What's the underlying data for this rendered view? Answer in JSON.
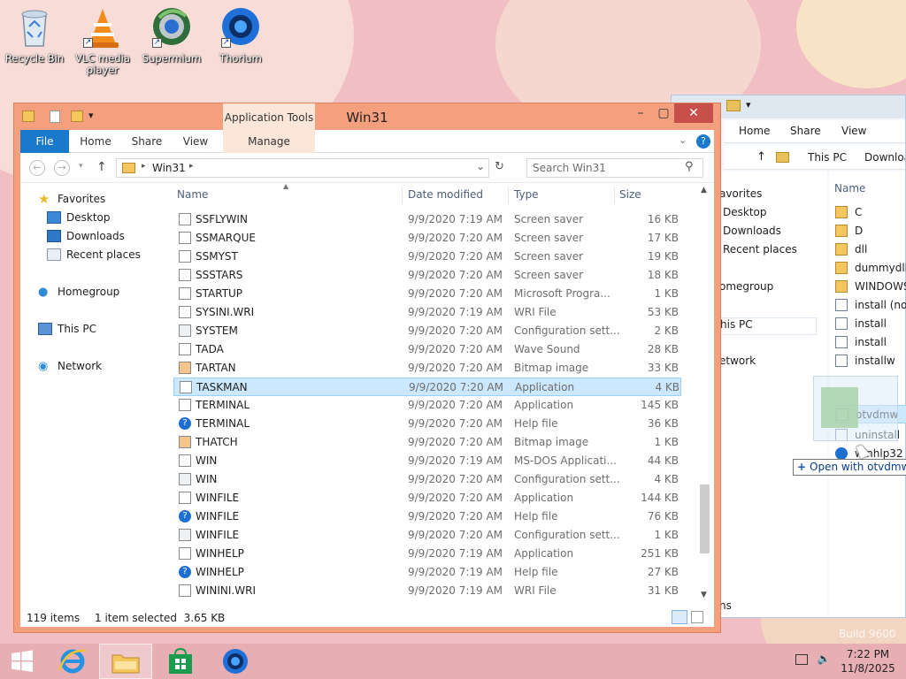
{
  "desktop": {
    "icons": [
      {
        "label": "Recycle Bin",
        "icon": "recycle-bin-icon"
      },
      {
        "label": "VLC media player",
        "icon": "vlc-icon"
      },
      {
        "label": "Supermium",
        "icon": "supermium-icon"
      },
      {
        "label": "Thorium",
        "icon": "thorium-icon"
      }
    ],
    "watermark": "Build 9600"
  },
  "main_window": {
    "title": "Win31",
    "context_tab": "Application Tools",
    "tabs": [
      "File",
      "Home",
      "Share",
      "View",
      "Manage"
    ],
    "address": "Win31",
    "search_placeholder": "Search Win31",
    "nav": {
      "favorites": "Favorites",
      "desktop": "Desktop",
      "downloads": "Downloads",
      "recent": "Recent places",
      "homegroup": "Homegroup",
      "this_pc": "This PC",
      "network": "Network"
    },
    "columns": {
      "name": "Name",
      "date": "Date modified",
      "type": "Type",
      "size": "Size"
    },
    "files": [
      {
        "name": "SSFLYWIN",
        "date": "9/9/2020 7:19 AM",
        "type": "Screen saver",
        "size": "16 KB",
        "icon": "app"
      },
      {
        "name": "SSMARQUE",
        "date": "9/9/2020 7:20 AM",
        "type": "Screen saver",
        "size": "17 KB",
        "icon": "app"
      },
      {
        "name": "SSMYST",
        "date": "9/9/2020 7:20 AM",
        "type": "Screen saver",
        "size": "19 KB",
        "icon": "app"
      },
      {
        "name": "SSSTARS",
        "date": "9/9/2020 7:20 AM",
        "type": "Screen saver",
        "size": "18 KB",
        "icon": "app"
      },
      {
        "name": "STARTUP",
        "date": "9/9/2020 7:20 AM",
        "type": "Microsoft Progra...",
        "size": "1 KB",
        "icon": "doc"
      },
      {
        "name": "SYSINI.WRI",
        "date": "9/9/2020 7:19 AM",
        "type": "WRI File",
        "size": "53 KB",
        "icon": "doc"
      },
      {
        "name": "SYSTEM",
        "date": "9/9/2020 7:20 AM",
        "type": "Configuration sett...",
        "size": "2 KB",
        "icon": "config"
      },
      {
        "name": "TADA",
        "date": "9/9/2020 7:20 AM",
        "type": "Wave Sound",
        "size": "28 KB",
        "icon": "sound"
      },
      {
        "name": "TARTAN",
        "date": "9/9/2020 7:20 AM",
        "type": "Bitmap image",
        "size": "33 KB",
        "icon": "bitmap"
      },
      {
        "name": "TASKMAN",
        "date": "9/9/2020 7:20 AM",
        "type": "Application",
        "size": "4 KB",
        "icon": "app",
        "selected": true
      },
      {
        "name": "TERMINAL",
        "date": "9/9/2020 7:20 AM",
        "type": "Application",
        "size": "145 KB",
        "icon": "app"
      },
      {
        "name": "TERMINAL",
        "date": "9/9/2020 7:20 AM",
        "type": "Help file",
        "size": "36 KB",
        "icon": "help"
      },
      {
        "name": "THATCH",
        "date": "9/9/2020 7:20 AM",
        "type": "Bitmap image",
        "size": "1 KB",
        "icon": "bitmap"
      },
      {
        "name": "WIN",
        "date": "9/9/2020 7:19 AM",
        "type": "MS-DOS Applicati...",
        "size": "44 KB",
        "icon": "app"
      },
      {
        "name": "WIN",
        "date": "9/9/2020 7:20 AM",
        "type": "Configuration sett...",
        "size": "4 KB",
        "icon": "config"
      },
      {
        "name": "WINFILE",
        "date": "9/9/2020 7:20 AM",
        "type": "Application",
        "size": "144 KB",
        "icon": "app"
      },
      {
        "name": "WINFILE",
        "date": "9/9/2020 7:20 AM",
        "type": "Help file",
        "size": "76 KB",
        "icon": "help"
      },
      {
        "name": "WINFILE",
        "date": "9/9/2020 7:20 AM",
        "type": "Configuration sett...",
        "size": "1 KB",
        "icon": "config"
      },
      {
        "name": "WINHELP",
        "date": "9/9/2020 7:19 AM",
        "type": "Application",
        "size": "251 KB",
        "icon": "app"
      },
      {
        "name": "WINHELP",
        "date": "9/9/2020 7:19 AM",
        "type": "Help file",
        "size": "27 KB",
        "icon": "help"
      },
      {
        "name": "WININI.WRI",
        "date": "9/9/2020 7:19 AM",
        "type": "WRI File",
        "size": "31 KB",
        "icon": "doc"
      }
    ],
    "status": {
      "count": "119 items",
      "selection": "1 item selected  3.65 KB"
    }
  },
  "back_window": {
    "tabs": [
      "Home",
      "Share",
      "View"
    ],
    "breadcrumb": [
      "This PC",
      "Downloa"
    ],
    "nav": [
      "avorites",
      "Desktop",
      "Downloads",
      "Recent places",
      "omegroup",
      "his PC",
      "etwork"
    ],
    "column": "Name",
    "files": [
      {
        "name": "C",
        "icon": "folder"
      },
      {
        "name": "D",
        "icon": "folder"
      },
      {
        "name": "dll",
        "icon": "folder"
      },
      {
        "name": "dummydll",
        "icon": "folder"
      },
      {
        "name": "WINDOWS",
        "icon": "folder"
      },
      {
        "name": "install (no c",
        "icon": "setup"
      },
      {
        "name": "install",
        "icon": "setup"
      },
      {
        "name": "install",
        "icon": "setup"
      },
      {
        "name": "installw",
        "icon": "setup"
      },
      {
        "name": "otvdmw",
        "icon": "app",
        "selected": true
      },
      {
        "name": "uninstall",
        "icon": "setup"
      },
      {
        "name": "winhlp32",
        "icon": "help"
      }
    ],
    "status": "ns"
  },
  "drag_tooltip": "Open with otvdmw",
  "taskbar": {
    "time": "7:22 PM",
    "date": "11/8/2025",
    "apps": [
      "internet-explorer-icon",
      "file-explorer-icon",
      "store-icon",
      "thorium-icon"
    ]
  },
  "colors": {
    "window_frame": "#f4a07f",
    "close_button": "#c7504a",
    "file_tab": "#1979ca",
    "selection": "#cce8ff",
    "taskbar": "#e7aeb3"
  }
}
